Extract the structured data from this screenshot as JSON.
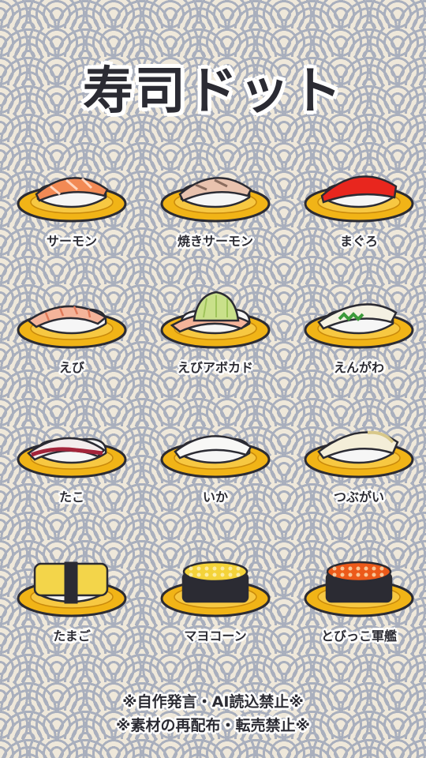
{
  "title": "寿司ドット",
  "items": [
    {
      "name": "サーモン",
      "topping": "salmon"
    },
    {
      "name": "焼きサーモン",
      "topping": "seared-salmon"
    },
    {
      "name": "まぐろ",
      "topping": "tuna"
    },
    {
      "name": "えび",
      "topping": "shrimp"
    },
    {
      "name": "えびアボカド",
      "topping": "shrimp-avocado"
    },
    {
      "name": "えんがわ",
      "topping": "engawa"
    },
    {
      "name": "たこ",
      "topping": "octopus"
    },
    {
      "name": "いか",
      "topping": "squid"
    },
    {
      "name": "つぶがい",
      "topping": "whelk"
    },
    {
      "name": "たまご",
      "topping": "egg"
    },
    {
      "name": "マヨコーン",
      "topping": "mayo-corn-gunkan"
    },
    {
      "name": "とびっこ軍艦",
      "topping": "tobiko-gunkan"
    }
  ],
  "notices": [
    "※自作発言・AI読込禁止※",
    "※素材の再配布・転売禁止※"
  ],
  "colors": {
    "plate": "#f1b417",
    "plate_outline": "#2b2b33",
    "rice": "#f6f6f6",
    "nori": "#2b2b33",
    "salmon": "#f28a55",
    "seared_salmon": "#e8c2ae",
    "tuna": "#e8261e",
    "shrimp": "#f4b49a",
    "avocado": "#c9e08a",
    "engawa": "#f4f1e2",
    "octopus": "#f4ecec",
    "squid": "#f8f8f6",
    "whelk": "#f4eed8",
    "egg": "#f3d54a",
    "corn": "#f4d33a",
    "tobiko": "#ec5a1a"
  }
}
